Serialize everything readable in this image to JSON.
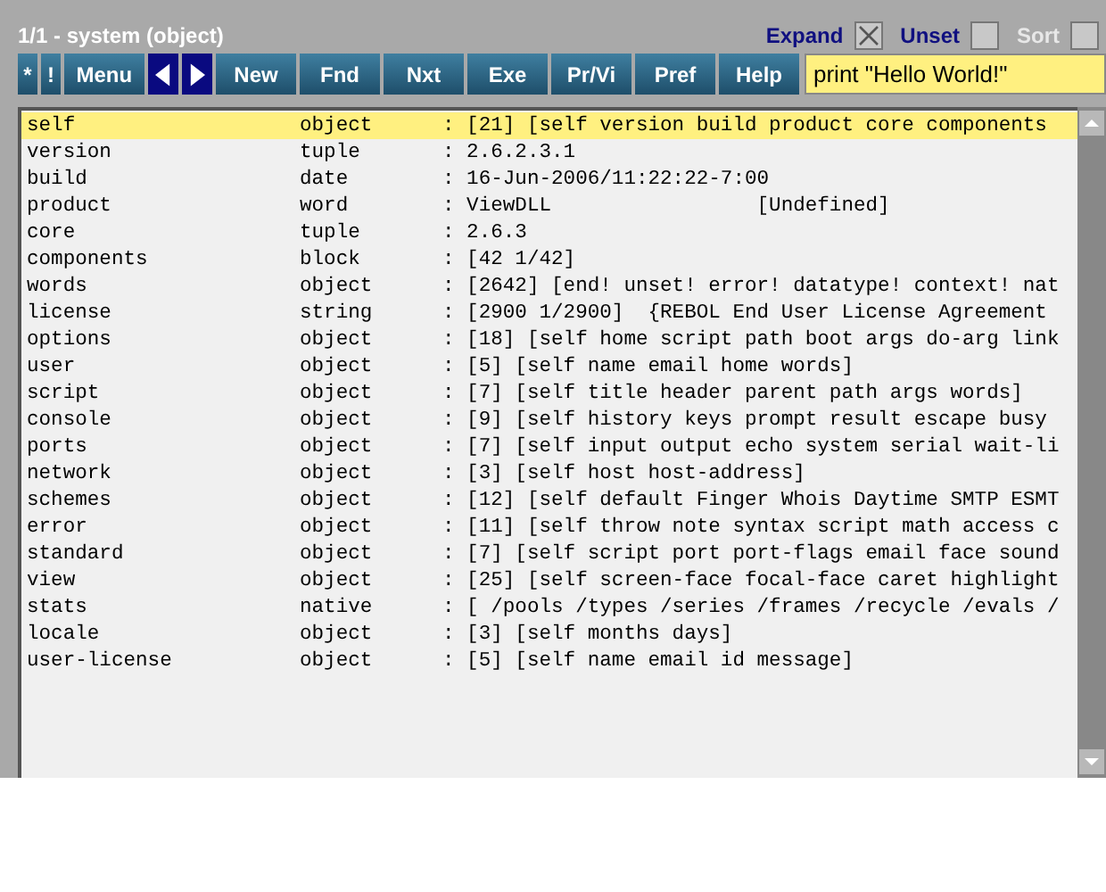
{
  "window": {
    "title": "1/1 - system (object)"
  },
  "options": [
    {
      "label": "Expand",
      "checked": true,
      "disabled": false
    },
    {
      "label": "Unset",
      "checked": false,
      "disabled": false
    },
    {
      "label": "Sort",
      "checked": false,
      "disabled": true
    }
  ],
  "toolbar": [
    {
      "kind": "text",
      "label": "*"
    },
    {
      "kind": "text",
      "label": "!"
    },
    {
      "kind": "text",
      "label": "Menu"
    },
    {
      "kind": "back"
    },
    {
      "kind": "forward"
    },
    {
      "kind": "text",
      "label": "New"
    },
    {
      "kind": "text",
      "label": "Fnd"
    },
    {
      "kind": "text",
      "label": "Nxt"
    },
    {
      "kind": "text",
      "label": "Exe"
    },
    {
      "kind": "text",
      "label": "Pr/Vi"
    },
    {
      "kind": "text",
      "label": "Pref"
    },
    {
      "kind": "text",
      "label": "Help"
    }
  ],
  "command": {
    "value": "print \"Hello World!\""
  },
  "rows": [
    {
      "name": "self",
      "type": "object",
      "value": ": [21] [self version build product core components",
      "selected": true
    },
    {
      "name": "version",
      "type": "tuple",
      "value": ": 2.6.2.3.1",
      "selected": false
    },
    {
      "name": "build",
      "type": "date",
      "value": ": 16-Jun-2006/11:22:22-7:00",
      "selected": false
    },
    {
      "name": "product",
      "type": "word",
      "value": ": ViewDLL                 [Undefined]",
      "selected": false
    },
    {
      "name": "core",
      "type": "tuple",
      "value": ": 2.6.3",
      "selected": false
    },
    {
      "name": "components",
      "type": "block",
      "value": ": [42 1/42]",
      "selected": false
    },
    {
      "name": "words",
      "type": "object",
      "value": ": [2642] [end! unset! error! datatype! context! nat",
      "selected": false
    },
    {
      "name": "license",
      "type": "string",
      "value": ": [2900 1/2900]  {REBOL End User License Agreement",
      "selected": false
    },
    {
      "name": "options",
      "type": "object",
      "value": ": [18] [self home script path boot args do-arg link",
      "selected": false
    },
    {
      "name": "user",
      "type": "object",
      "value": ": [5] [self name email home words]",
      "selected": false
    },
    {
      "name": "script",
      "type": "object",
      "value": ": [7] [self title header parent path args words]",
      "selected": false
    },
    {
      "name": "console",
      "type": "object",
      "value": ": [9] [self history keys prompt result escape busy",
      "selected": false
    },
    {
      "name": "ports",
      "type": "object",
      "value": ": [7] [self input output echo system serial wait-li",
      "selected": false
    },
    {
      "name": "network",
      "type": "object",
      "value": ": [3] [self host host-address]",
      "selected": false
    },
    {
      "name": "schemes",
      "type": "object",
      "value": ": [12] [self default Finger Whois Daytime SMTP ESMT",
      "selected": false
    },
    {
      "name": "error",
      "type": "object",
      "value": ": [11] [self throw note syntax script math access c",
      "selected": false
    },
    {
      "name": "standard",
      "type": "object",
      "value": ": [7] [self script port port-flags email face sound",
      "selected": false
    },
    {
      "name": "view",
      "type": "object",
      "value": ": [25] [self screen-face focal-face caret highlight",
      "selected": false
    },
    {
      "name": "stats",
      "type": "native",
      "value": ": [ /pools /types /series /frames /recycle /evals /",
      "selected": false
    },
    {
      "name": "locale",
      "type": "object",
      "value": ": [3] [self months days]",
      "selected": false
    },
    {
      "name": "user-license",
      "type": "object",
      "value": ": [5] [self name email id message]",
      "selected": false
    }
  ]
}
